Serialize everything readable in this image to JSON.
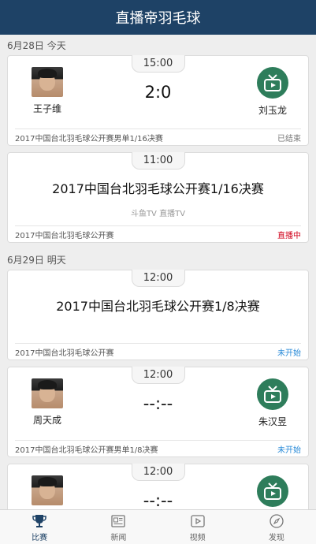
{
  "header": {
    "title": "直播帝羽毛球"
  },
  "sections": [
    {
      "date": "6月28日 今天"
    },
    {
      "date": "6月29日 明天"
    }
  ],
  "cards": [
    {
      "time": "15:00",
      "left": "王子维",
      "right": "刘玉龙",
      "score": "2:0",
      "foot": "2017中国台北羽毛球公开赛男单1/16决赛",
      "status": "已结束"
    },
    {
      "time": "11:00",
      "title": "2017中国台北羽毛球公开赛1/16决赛",
      "channels": "斗鱼TV 直播TV",
      "foot": "2017中国台北羽毛球公开赛",
      "status": "直播中"
    },
    {
      "time": "12:00",
      "title": "2017中国台北羽毛球公开赛1/8决赛",
      "foot": "2017中国台北羽毛球公开赛",
      "status": "未开始"
    },
    {
      "time": "12:00",
      "left": "周天成",
      "right": "朱汉昱",
      "score": "--:--",
      "foot": "2017中国台北羽毛球公开赛男单1/8决赛",
      "status": "未开始"
    },
    {
      "time": "12:00",
      "score": "--:--"
    }
  ],
  "tabs": [
    {
      "label": "比赛",
      "icon": "trophy-icon"
    },
    {
      "label": "新闻",
      "icon": "news-icon"
    },
    {
      "label": "视频",
      "icon": "video-icon"
    },
    {
      "label": "发现",
      "icon": "compass-icon"
    }
  ],
  "colors": {
    "header": "#1e4266",
    "live": "#d0021b",
    "upcoming": "#2a8bd8",
    "logo": "#2e7d5b"
  }
}
